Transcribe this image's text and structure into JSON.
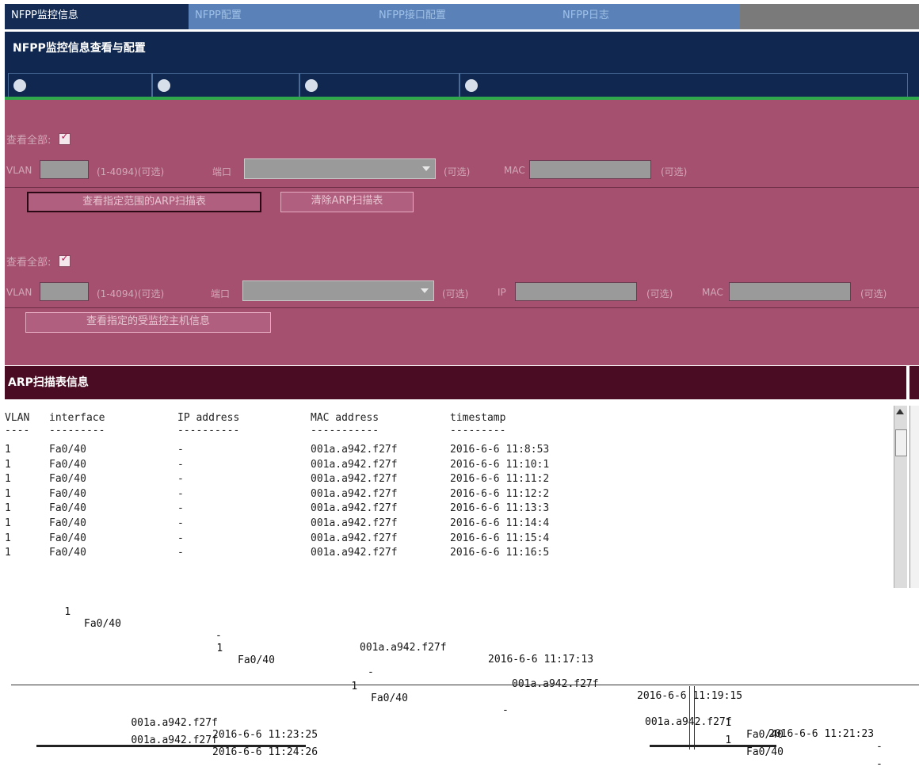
{
  "tabs": [
    {
      "label": "NFPP监控信息"
    },
    {
      "label": "NFPP配置"
    },
    {
      "label": "NFPP接口配置"
    },
    {
      "label": "NFPP日志"
    }
  ],
  "header": {
    "title": "NFPP监控信息查看与配置"
  },
  "arp_scan": {
    "view_all_label": "查看全部:",
    "vlan_label": "VLAN",
    "vlan_range": "(1-4094)(可选)",
    "port_label": "端口",
    "optional": "(可选)",
    "mac_label": "MAC",
    "view_button": "查看指定范围的ARP扫描表",
    "clear_button": "清除ARP扫描表"
  },
  "monitored_host": {
    "view_all_label": "查看全部:",
    "vlan_label": "VLAN",
    "vlan_range": "(1-4094)(可选)",
    "port_label": "端口",
    "optional": "(可选)",
    "ip_label": "IP",
    "mac_label": "MAC",
    "view_button": "查看指定的受监控主机信息"
  },
  "arp_table": {
    "section_title": "ARP扫描表信息",
    "headers": [
      "VLAN",
      "interface",
      "IP address",
      "MAC address",
      "timestamp"
    ],
    "underline": [
      "----",
      "---------",
      "----------",
      "-----------",
      "---------"
    ],
    "rows": [
      [
        "1",
        "Fa0/40",
        "-",
        "001a.a942.f27f",
        "2016-6-6 11:8:53"
      ],
      [
        "1",
        "Fa0/40",
        "-",
        "001a.a942.f27f",
        "2016-6-6 11:10:1"
      ],
      [
        "1",
        "Fa0/40",
        "-",
        "001a.a942.f27f",
        "2016-6-6 11:11:2"
      ],
      [
        "1",
        "Fa0/40",
        "-",
        "001a.a942.f27f",
        "2016-6-6 11:12:2"
      ],
      [
        "1",
        "Fa0/40",
        "-",
        "001a.a942.f27f",
        "2016-6-6 11:13:3"
      ],
      [
        "1",
        "Fa0/40",
        "-",
        "001a.a942.f27f",
        "2016-6-6 11:14:4"
      ],
      [
        "1",
        "Fa0/40",
        "-",
        "001a.a942.f27f",
        "2016-6-6 11:15:4"
      ],
      [
        "1",
        "Fa0/40",
        "-",
        "001a.a942.f27f",
        "2016-6-6 11:16:5"
      ]
    ]
  },
  "overflow_rows": [
    {
      "vlan": "1",
      "iface": "Fa0/40",
      "ip": "-",
      "mac": "001a.a942.f27f",
      "ts": "2016-6-6 11:17:13"
    },
    {
      "vlan": "1",
      "iface": "Fa0/40",
      "ip": "-",
      "mac": "001a.a942.f27f",
      "ts": "2016-6-6 11:19:15"
    },
    {
      "vlan": "1",
      "iface": "Fa0/40",
      "ip": "-",
      "mac": "001a.a942.f27f",
      "ts": "2016-6-6 11:21:23"
    },
    {
      "mac": "001a.a942.f27f",
      "ts": "2016-6-6 11:23:25"
    },
    {
      "mac": "001a.a942.f27f",
      "ts": "2016-6-6 11:24:26"
    },
    {
      "vlan": "1",
      "iface": "Fa0/40",
      "ip": "-"
    },
    {
      "vlan": "1",
      "iface": "Fa0/40",
      "ip": "-"
    }
  ]
}
